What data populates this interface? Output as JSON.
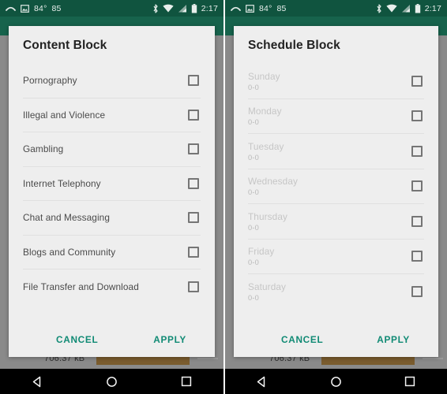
{
  "status_bar": {
    "icons_left": [
      "swipe-arc-icon",
      "image-icon"
    ],
    "temperature": "84°",
    "secondary_value": "85",
    "icons_right": [
      "bluetooth-icon",
      "wifi-icon",
      "signal-icon",
      "battery-icon"
    ],
    "time": "2:17"
  },
  "backdrop": {
    "file_size": "706.37 kB"
  },
  "theme": {
    "status_bar_color": "#10543f",
    "app_bar_color": "#17634c",
    "accent_color": "#108a74",
    "dialog_bg": "#eeeeee",
    "backdrop_color": "#8a8a8a",
    "chip_color": "#7a5c2e"
  },
  "left_dialog": {
    "title": "Content Block",
    "items": [
      {
        "label": "Pornography",
        "checked": false
      },
      {
        "label": "Illegal and Violence",
        "checked": false
      },
      {
        "label": "Gambling",
        "checked": false
      },
      {
        "label": "Internet Telephony",
        "checked": false
      },
      {
        "label": "Chat and Messaging",
        "checked": false
      },
      {
        "label": "Blogs and Community",
        "checked": false
      },
      {
        "label": "File Transfer and Download",
        "checked": false
      }
    ],
    "cancel_label": "CANCEL",
    "apply_label": "APPLY"
  },
  "right_dialog": {
    "title": "Schedule Block",
    "items": [
      {
        "label": "Sunday",
        "sub": "0-0",
        "checked": false,
        "disabled": true
      },
      {
        "label": "Monday",
        "sub": "0-0",
        "checked": false,
        "disabled": true
      },
      {
        "label": "Tuesday",
        "sub": "0-0",
        "checked": false,
        "disabled": true
      },
      {
        "label": "Wednesday",
        "sub": "0-0",
        "checked": false,
        "disabled": true
      },
      {
        "label": "Thursday",
        "sub": "0-0",
        "checked": false,
        "disabled": true
      },
      {
        "label": "Friday",
        "sub": "0-0",
        "checked": false,
        "disabled": true
      },
      {
        "label": "Saturday",
        "sub": "0-0",
        "checked": false,
        "disabled": true
      }
    ],
    "cancel_label": "CANCEL",
    "apply_label": "APPLY"
  },
  "nav_bar": {
    "buttons": [
      "back-icon",
      "home-icon",
      "recents-icon"
    ]
  }
}
